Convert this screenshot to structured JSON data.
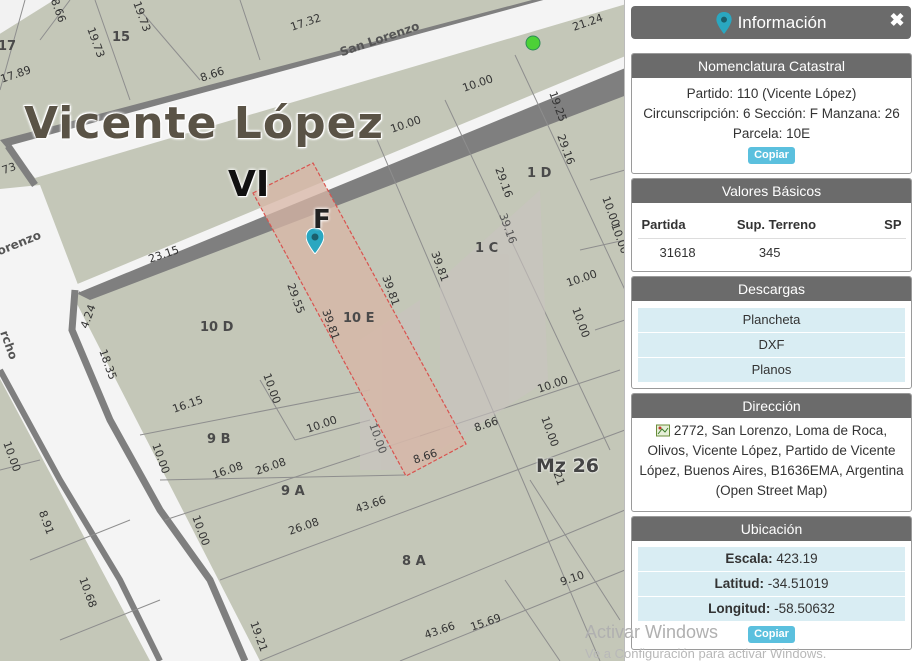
{
  "map": {
    "municipality_label": "Vicente López",
    "circunscripcion_label": "VI",
    "seccion_label": "F",
    "manzana_label": "Mz 26",
    "streets": [
      "San Lorenzo",
      "orenzo",
      "rcho"
    ],
    "lots": [
      "15",
      "1 D",
      "1 C",
      "10 E",
      "10 D",
      "9 B",
      "9 A",
      "8 A",
      "17"
    ],
    "dimensions": [
      "17.32",
      "21.24",
      "10.00",
      "19.25",
      "29.16",
      "8.66",
      "19.73",
      "19.73",
      "17.89",
      "8.66",
      "73",
      "23.15",
      "10.00",
      "29.16",
      "39.16",
      "10.00",
      "39.81",
      "29.55",
      "39.81",
      "39.81",
      "10.00",
      "10.00",
      "4.24",
      "18.35",
      "16.15",
      "10.00",
      "10.00",
      "10.00",
      "16.08",
      "26.08",
      "8.66",
      "8.66",
      "10.00",
      "10.00",
      "10.00",
      "43.66",
      "26.08",
      "21",
      "10.00",
      "8.91",
      "10.68",
      "9.10",
      "43.66",
      "15.69",
      "19.21",
      "10.00",
      "10.00"
    ]
  },
  "panel": {
    "title": "Información",
    "close_icon": "close-icon",
    "nomenclatura": {
      "header": "Nomenclatura Catastral",
      "line1": "Partido: 110 (Vicente López)",
      "line2": "Circunscripción: 6 Sección: F Manzana: 26",
      "line3": "Parcela: 10E",
      "copy_label": "Copiar"
    },
    "valores": {
      "header": "Valores Básicos",
      "columns": [
        "Partida",
        "Sup. Terreno",
        "SP"
      ],
      "row": [
        "31618",
        "345",
        ""
      ]
    },
    "descargas": {
      "header": "Descargas",
      "items": [
        "Plancheta",
        "DXF",
        "Planos"
      ]
    },
    "direccion": {
      "header": "Dirección",
      "text": "2772, San Lorenzo, Loma de Roca, Olivos, Vicente López, Partido de Vicente López, Buenos Aires, B1636EMA, Argentina (Open Street Map)"
    },
    "ubicacion": {
      "header": "Ubicación",
      "escala_label": "Escala:",
      "escala_value": "423.19",
      "latitud_label": "Latitud:",
      "latitud_value": "-34.51019",
      "longitud_label": "Longitud:",
      "longitud_value": "-58.50632",
      "copy_label": "Copiar"
    }
  },
  "watermark": {
    "line1": "Activar Windows",
    "line2": "Ve a Configuración para activar Windows."
  },
  "colors": {
    "header_gray": "#6b6b6b",
    "accent_blue": "#5bc0de",
    "row_blue": "#d9edf3",
    "parcel_highlight": "#d8b5a6",
    "parcel_border": "#d9534f",
    "marker": "#2aa7c0"
  }
}
